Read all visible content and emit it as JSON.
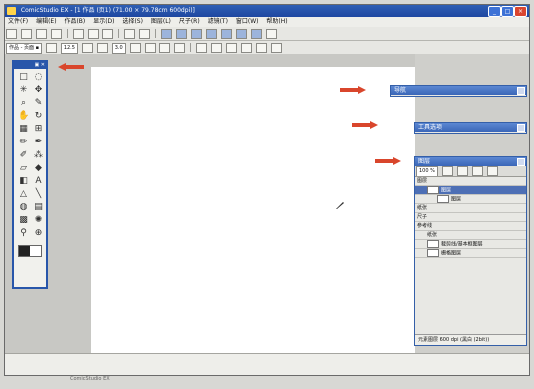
{
  "window": {
    "title": "ComicStudio EX - [1 作品  (页1) (71.00 × 79.78cm 600dpi)]",
    "controls": [
      "_",
      "□",
      "×"
    ]
  },
  "menu": [
    "文件(F)",
    "编辑(E)",
    "作品(B)",
    "显示(D)",
    "选择(S)",
    "图层(L)",
    "尺子(R)",
    "滤镜(T)",
    "窗口(W)",
    "帮助(H)"
  ],
  "tabs": {
    "doc_tab": "作品 - 页面 ▪"
  },
  "toolbar2": {
    "size_value": "12.5",
    "value2": "3.0"
  },
  "panels": {
    "nav": {
      "title": "导航"
    },
    "tool_options": {
      "title": "工具选项"
    },
    "layers": {
      "title": "图层",
      "zoom": "100 %",
      "rows": [
        {
          "label": "图层",
          "indent": 0,
          "selected": false
        },
        {
          "label": "图层",
          "indent": 1,
          "selected": true
        },
        {
          "label": "图层",
          "indent": 2,
          "selected": false
        },
        {
          "label": "纸张",
          "indent": 0,
          "selected": false
        },
        {
          "label": "尺子",
          "indent": 0,
          "selected": false
        },
        {
          "label": "参考线",
          "indent": 0,
          "selected": false
        },
        {
          "label": "纸张",
          "indent": 1,
          "selected": false
        },
        {
          "label": "裁剪线/基本框图层",
          "indent": 1,
          "selected": false
        },
        {
          "label": "栅格图层",
          "indent": 1,
          "selected": false
        }
      ],
      "status": "元素图层 600 dpi (黑白 (2bit))"
    }
  },
  "caption": "ComicStudio EX"
}
